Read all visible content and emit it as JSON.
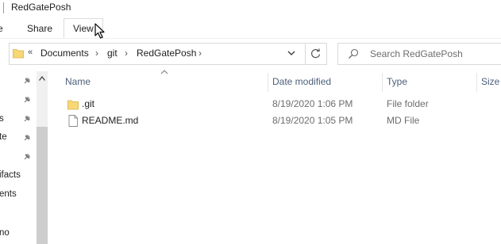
{
  "window": {
    "title": "RedGatePosh"
  },
  "ribbon": {
    "tabs": [
      {
        "label": "e"
      },
      {
        "label": "Share"
      },
      {
        "label": "View"
      }
    ]
  },
  "address": {
    "overflow": "«",
    "crumbs": [
      "Documents",
      "git",
      "RedGatePosh"
    ],
    "separator": "›"
  },
  "search": {
    "placeholder": "Search RedGatePosh"
  },
  "nav": {
    "items": [
      {
        "label": "s"
      },
      {
        "label": "te"
      },
      {
        "label": "ifacts"
      },
      {
        "label": "ents"
      },
      {
        "label": "no"
      }
    ]
  },
  "columns": {
    "name": "Name",
    "date": "Date modified",
    "type": "Type",
    "size": "Size"
  },
  "files": [
    {
      "name": ".git",
      "date": "8/19/2020 1:06 PM",
      "type": "File folder",
      "icon": "folder-icon"
    },
    {
      "name": "README.md",
      "date": "8/19/2020 1:05 PM",
      "type": "MD File",
      "icon": "file-icon"
    }
  ],
  "colors": {
    "folder": "#f8d775",
    "header_text": "#4c607a",
    "secondary_text": "#6d6d6d"
  }
}
